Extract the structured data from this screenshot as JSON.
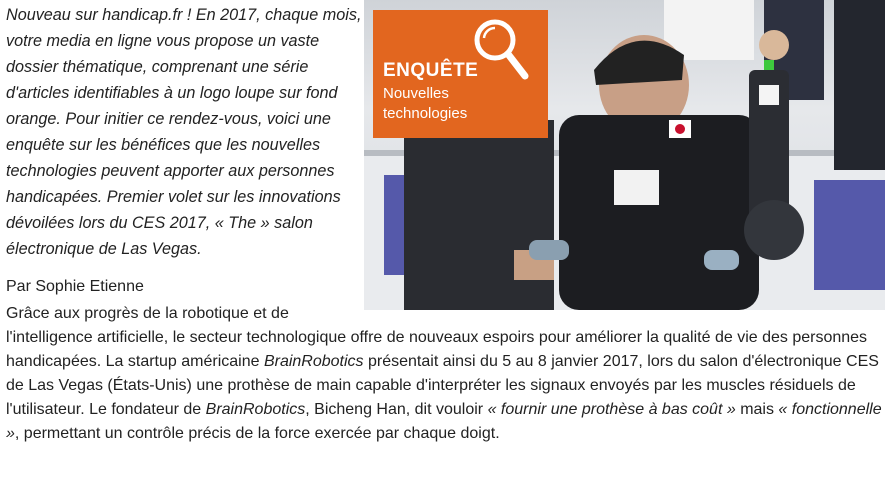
{
  "intro": "Nouveau sur handicap.fr ! En 2017, chaque mois, votre media en ligne vous propose un vaste dossier thématique, comprenant une série d'articles identifiables à un logo loupe sur fond orange. Pour initier ce rendez-vous, voici une enquête sur les bénéfices que les nouvelles technologies peuvent apporter aux personnes handicapées. Premier volet sur les innovations dévoilées lors du CES 2017, « The » salon électronique de Las Vegas.",
  "byline": "Par Sophie Etienne",
  "badge": {
    "title": "ENQUÊTE",
    "subtitle": "Nouvelles technologies",
    "color": "#e2661f",
    "icon": "magnifier-icon"
  },
  "photo": {
    "icon": "exoskeleton-photo"
  },
  "body": {
    "line1": "Grâce aux progrès de la robotique et de",
    "p1": "l'intelligence artificielle, le secteur technologique offre de nouveaux espoirs pour améliorer la qualité de vie des personnes handicapées. La startup américaine ",
    "brand1": "BrainRobotics",
    "p2": " présentait ainsi du 5 au 8 janvier 2017, lors du salon d'électronique CES de Las Vegas (États-Unis) une prothèse de main capable d'interpréter les signaux envoyés par les muscles résiduels de l'utilisateur. Le fondateur de ",
    "brand2": "BrainRobotics",
    "p3": ", Bicheng Han, dit vouloir ",
    "quote1": "« fournir une prothèse à bas coût »",
    "p4": " mais ",
    "quote2": "« fonctionnelle »",
    "p5": ", permettant un contrôle précis de la force exercée par chaque doigt."
  }
}
